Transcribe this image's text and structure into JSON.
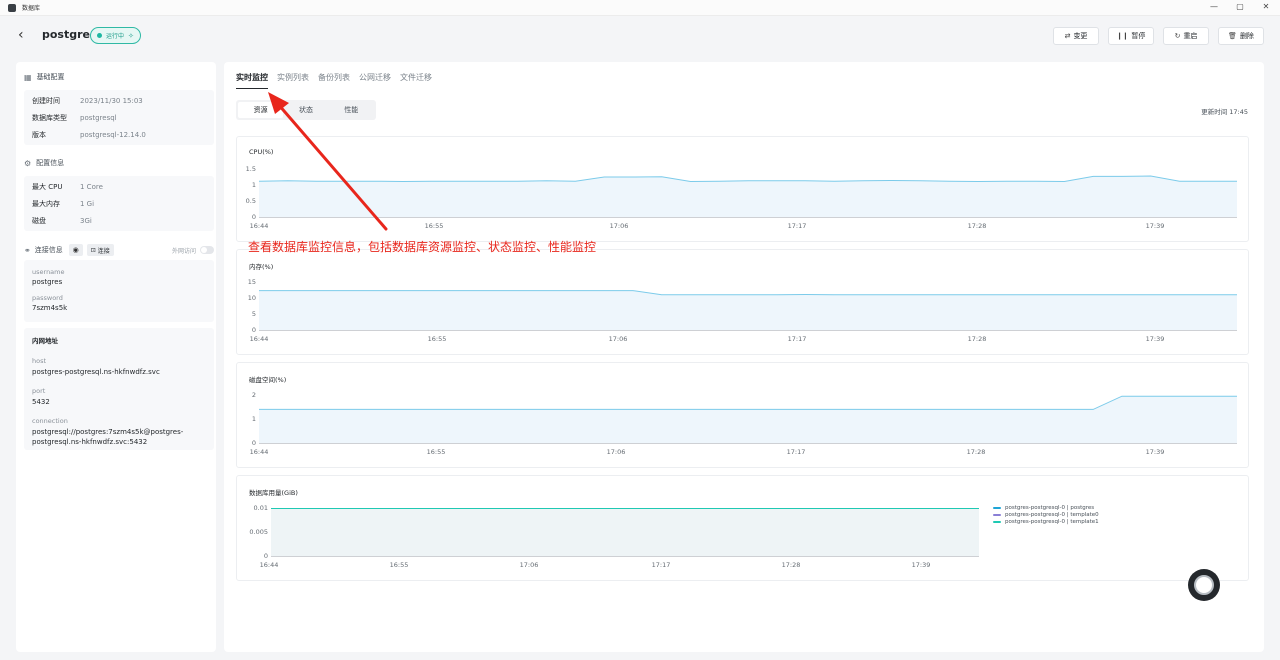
{
  "window": {
    "title": "数据库",
    "controls": [
      "—",
      "▢",
      "✕"
    ]
  },
  "header": {
    "back_icon": "chevron-left-icon",
    "db_name": "postgres",
    "status": "运行中",
    "actions": [
      {
        "label": "变更",
        "icon": "swap-icon",
        "glyph": "⇄"
      },
      {
        "label": "暂停",
        "icon": "pause-icon",
        "glyph": "❙❙"
      },
      {
        "label": "重启",
        "icon": "restart-icon",
        "glyph": "↻"
      },
      {
        "label": "删除",
        "icon": "trash-icon",
        "glyph": "🗑"
      }
    ]
  },
  "sidebar": {
    "basic": {
      "title": "基础配置",
      "rows": [
        {
          "k": "创建时间",
          "v": "2023/11/30 15:03"
        },
        {
          "k": "数据库类型",
          "v": "postgresql"
        },
        {
          "k": "版本",
          "v": "postgresql-12.14.0"
        }
      ]
    },
    "config": {
      "title": "配置信息",
      "rows": [
        {
          "k": "最大 CPU",
          "v": "1 Core"
        },
        {
          "k": "最大内存",
          "v": "1 Gi"
        },
        {
          "k": "磁盘",
          "v": "3Gi"
        }
      ]
    },
    "connection": {
      "title": "连接信息",
      "copy_label": "连接",
      "external_label": "外网访问",
      "username_key": "username",
      "username": "postgres",
      "password_key": "password",
      "password": "7szm4s5k"
    },
    "internal": {
      "title": "内网地址",
      "host_key": "host",
      "host": "postgres-postgresql.ns-hkfnwdfz.svc",
      "port_key": "port",
      "port": "5432",
      "connection_key": "connection",
      "connection_line1": "postgresql://postgres:7szm4s5k@postgres-",
      "connection_line2": "postgresql.ns-hkfnwdfz.svc:5432"
    }
  },
  "main": {
    "tabs": [
      "实时监控",
      "实例列表",
      "备份列表",
      "公网迁移",
      "文件迁移"
    ],
    "segments": [
      "资源",
      "状态",
      "性能"
    ],
    "updated": "更新时间 17:45"
  },
  "annotation": {
    "text": "查看数据库监控信息，包括数据库资源监控、状态监控、性能监控",
    "color": "#e8261c"
  },
  "colors": {
    "accent": "#1fb8a2",
    "line": "#7ccbea",
    "fill": "#eef6fc"
  },
  "chart_data": [
    {
      "type": "area",
      "title": "CPU(%)",
      "x_ticks": [
        "16:44",
        "16:55",
        "17:06",
        "17:17",
        "17:28",
        "17:39"
      ],
      "y_ticks": [
        "1.5",
        "1",
        "0.5",
        "0"
      ],
      "ylim": [
        0,
        1.5
      ],
      "series": [
        {
          "values": [
            1.12,
            1.13,
            1.12,
            1.12,
            1.12,
            1.11,
            1.12,
            1.12,
            1.12,
            1.12,
            1.13,
            1.12,
            1.25,
            1.25,
            1.26,
            1.11,
            1.12,
            1.13,
            1.13,
            1.13,
            1.12,
            1.13,
            1.14,
            1.13,
            1.12,
            1.11,
            1.12,
            1.12,
            1.11,
            1.27,
            1.27,
            1.28,
            1.12,
            1.12,
            1.12
          ]
        }
      ]
    },
    {
      "type": "area",
      "title": "内存(%)",
      "x_ticks": [
        "16:44",
        "16:55",
        "17:06",
        "17:17",
        "17:28",
        "17:39"
      ],
      "y_ticks": [
        "15",
        "10",
        "5",
        "0"
      ],
      "ylim": [
        0,
        15
      ],
      "series": [
        {
          "values": [
            12.3,
            12.3,
            12.3,
            12.3,
            12.3,
            12.3,
            12.3,
            12.3,
            12.3,
            12.3,
            12.3,
            12.3,
            12.3,
            12.3,
            11.0,
            11.0,
            11.0,
            11.0,
            11.0,
            11.1,
            11.0,
            11.0,
            11.0,
            11.0,
            11.0,
            11.0,
            11.0,
            11.0,
            11.0,
            11.0,
            11.0,
            11.0,
            11.0,
            11.0,
            11.0
          ]
        }
      ]
    },
    {
      "type": "area",
      "title": "磁盘空间(%)",
      "x_ticks": [
        "16:44",
        "16:55",
        "17:06",
        "17:17",
        "17:28",
        "17:39"
      ],
      "y_ticks": [
        "2",
        "1",
        "0"
      ],
      "ylim": [
        0,
        2
      ],
      "series": [
        {
          "values": [
            1.4,
            1.4,
            1.4,
            1.4,
            1.4,
            1.4,
            1.4,
            1.4,
            1.4,
            1.4,
            1.4,
            1.4,
            1.4,
            1.4,
            1.4,
            1.4,
            1.4,
            1.4,
            1.4,
            1.4,
            1.4,
            1.4,
            1.4,
            1.4,
            1.4,
            1.4,
            1.4,
            1.4,
            1.4,
            1.4,
            1.95,
            1.95,
            1.95,
            1.95,
            1.95
          ]
        }
      ]
    },
    {
      "type": "area",
      "title": "数据库用量(GiB)",
      "x_ticks": [
        "16:44",
        "16:55",
        "17:06",
        "17:17",
        "17:28",
        "17:39"
      ],
      "y_ticks": [
        "0.01",
        "0.005",
        "0"
      ],
      "ylim": [
        0,
        0.01
      ],
      "legend_position": "right",
      "series": [
        {
          "name": "postgres-postgresql-0 | postgres",
          "color": "#1fa5d6",
          "values": [
            0.0099,
            0.0099,
            0.0099,
            0.0099,
            0.0099,
            0.0099,
            0.0099,
            0.0099,
            0.0099,
            0.0099,
            0.0099,
            0.0099,
            0.0099,
            0.0099,
            0.0099,
            0.0099,
            0.0099,
            0.0099,
            0.0099,
            0.0099,
            0.0099,
            0.0099,
            0.0099,
            0.0099,
            0.0099,
            0.0099,
            0.0099,
            0.0099,
            0.0099,
            0.0099,
            0.0099,
            0.0099,
            0.0099,
            0.0099,
            0.0099
          ]
        },
        {
          "name": "postgres-postgresql-0 | template0",
          "color": "#8a7fd6",
          "values": [
            0.0099,
            0.0099,
            0.0099,
            0.0099,
            0.0099,
            0.0099,
            0.0099,
            0.0099,
            0.0099,
            0.0099,
            0.0099,
            0.0099,
            0.0099,
            0.0099,
            0.0099,
            0.0099,
            0.0099,
            0.0099,
            0.0099,
            0.0099,
            0.0099,
            0.0099,
            0.0099,
            0.0099,
            0.0099,
            0.0099,
            0.0099,
            0.0099,
            0.0099,
            0.0099,
            0.0099,
            0.0099,
            0.0099,
            0.0099,
            0.0099
          ]
        },
        {
          "name": "postgres-postgresql-0 | template1",
          "color": "#1fc9b3",
          "values": [
            0.0099,
            0.0099,
            0.0099,
            0.0099,
            0.0099,
            0.0099,
            0.0099,
            0.0099,
            0.0099,
            0.0099,
            0.0099,
            0.0099,
            0.0099,
            0.0099,
            0.0099,
            0.0099,
            0.0099,
            0.0099,
            0.0099,
            0.0099,
            0.0099,
            0.0099,
            0.0099,
            0.0099,
            0.0099,
            0.0099,
            0.0099,
            0.0099,
            0.0099,
            0.0099,
            0.0099,
            0.0099,
            0.0099,
            0.0099,
            0.0099
          ]
        }
      ]
    }
  ]
}
